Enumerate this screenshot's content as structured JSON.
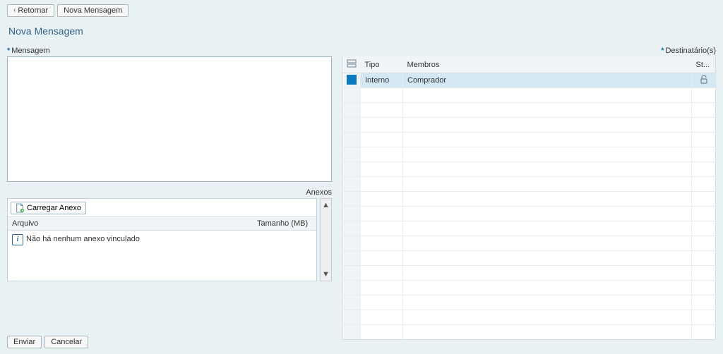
{
  "toolbar": {
    "back_label": "Retornar",
    "new_label": "Nova Mensagem"
  },
  "page_title": "Nova Mensagem",
  "message": {
    "label": "Mensagem",
    "value": ""
  },
  "attachments": {
    "section_label": "Anexos",
    "upload_label": "Carregar Anexo",
    "col_file": "Arquivo",
    "col_size": "Tamanho (MB)",
    "empty_text": "Não há nenhum anexo vinculado"
  },
  "recipients": {
    "label": "Destinatário(s)",
    "col_tipo": "Tipo",
    "col_membros": "Membros",
    "col_st": "St...",
    "rows": [
      {
        "tipo": "Interno",
        "membros": "Comprador",
        "selected": true
      }
    ]
  },
  "footer": {
    "send": "Enviar",
    "cancel": "Cancelar"
  }
}
